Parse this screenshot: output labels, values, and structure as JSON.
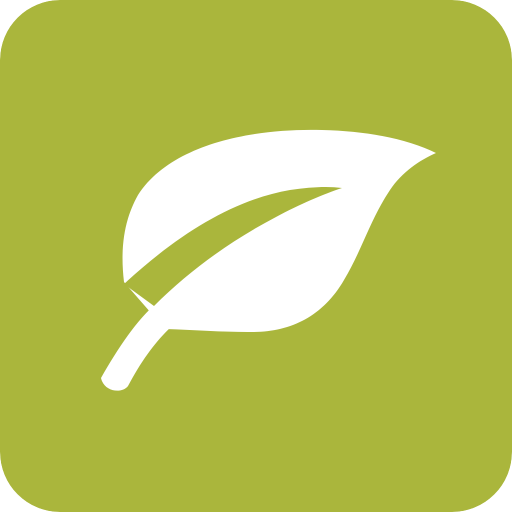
{
  "app_icon": {
    "icon": "leaf-icon",
    "background_color": "#AAB63C",
    "leaf_color": "#FFFFFF"
  }
}
